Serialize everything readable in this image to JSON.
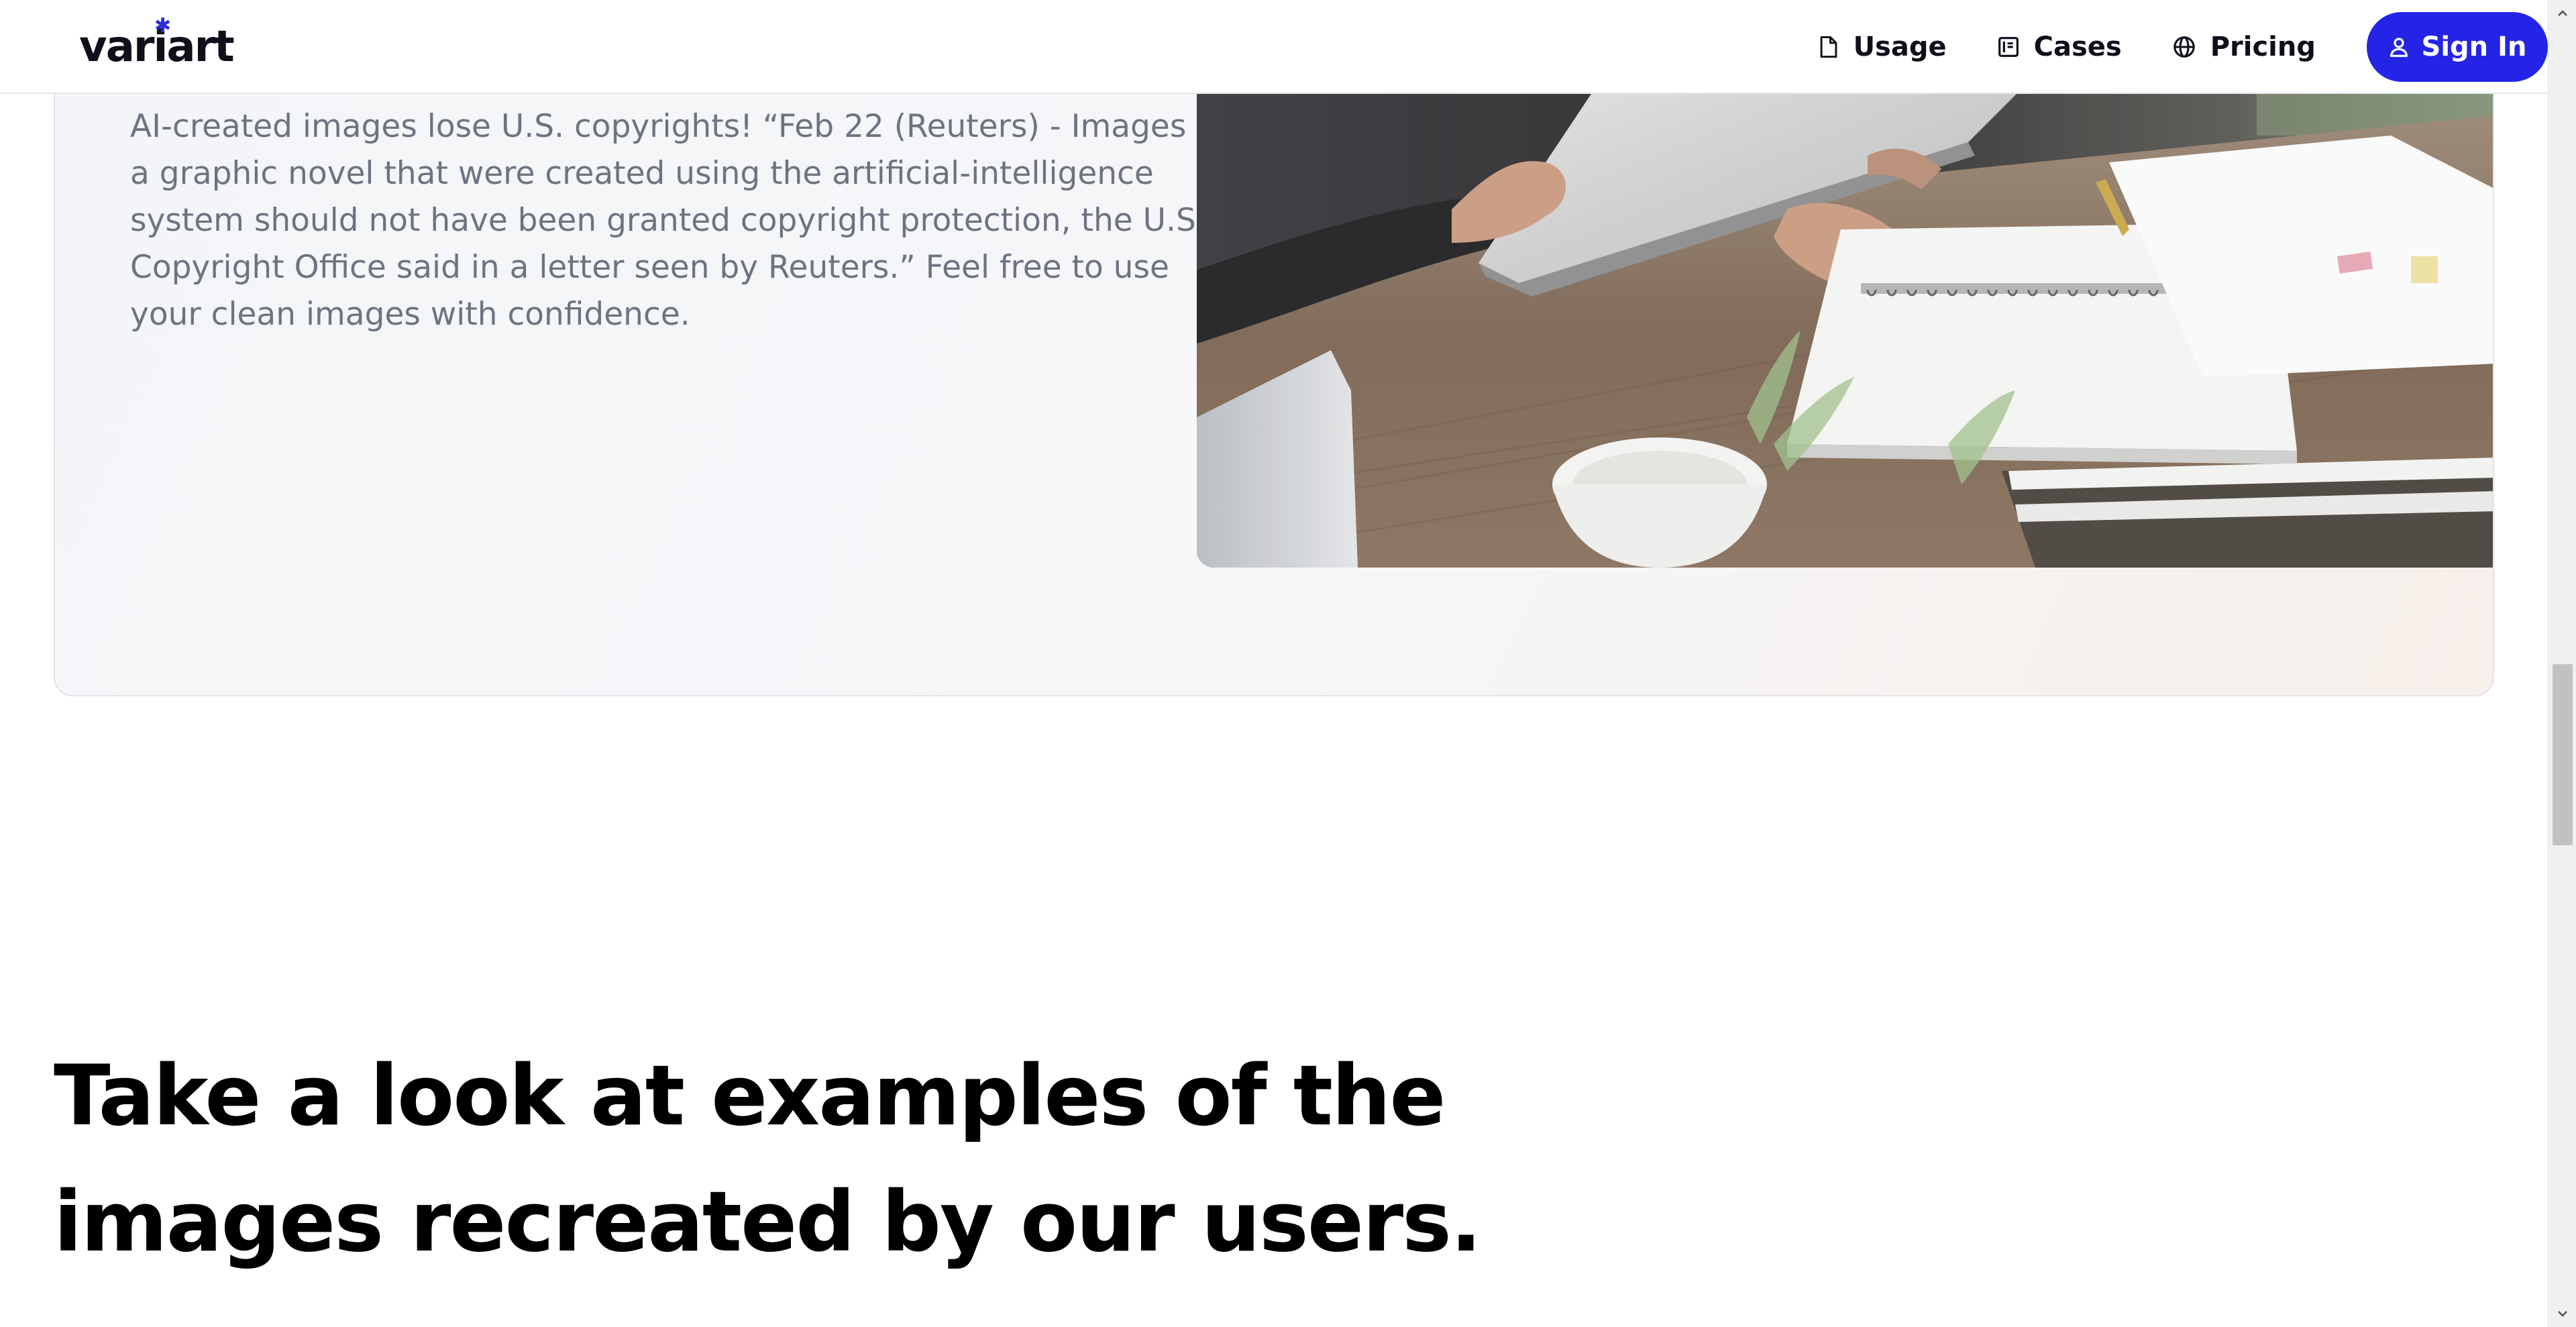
{
  "brand": {
    "name": "variart"
  },
  "nav": {
    "items": [
      {
        "label": "Usage",
        "icon": "document-icon"
      },
      {
        "label": "Cases",
        "icon": "book-icon"
      },
      {
        "label": "Pricing",
        "icon": "globe-icon"
      }
    ],
    "signin_label": "Sign In",
    "accent_color": "#2424e6"
  },
  "card": {
    "body": "AI-created images lose U.S. copyrights! “Feb 22 (Reuters) - Images in a graphic novel that were created using the artificial-intelligence system should not have been granted copyright protection, the U.S. Copyright Office said in a letter seen by Reuters.” Feel free to use your clean images with confidence."
  },
  "section": {
    "heading": "Take a look at examples of the images recreated by our users."
  }
}
